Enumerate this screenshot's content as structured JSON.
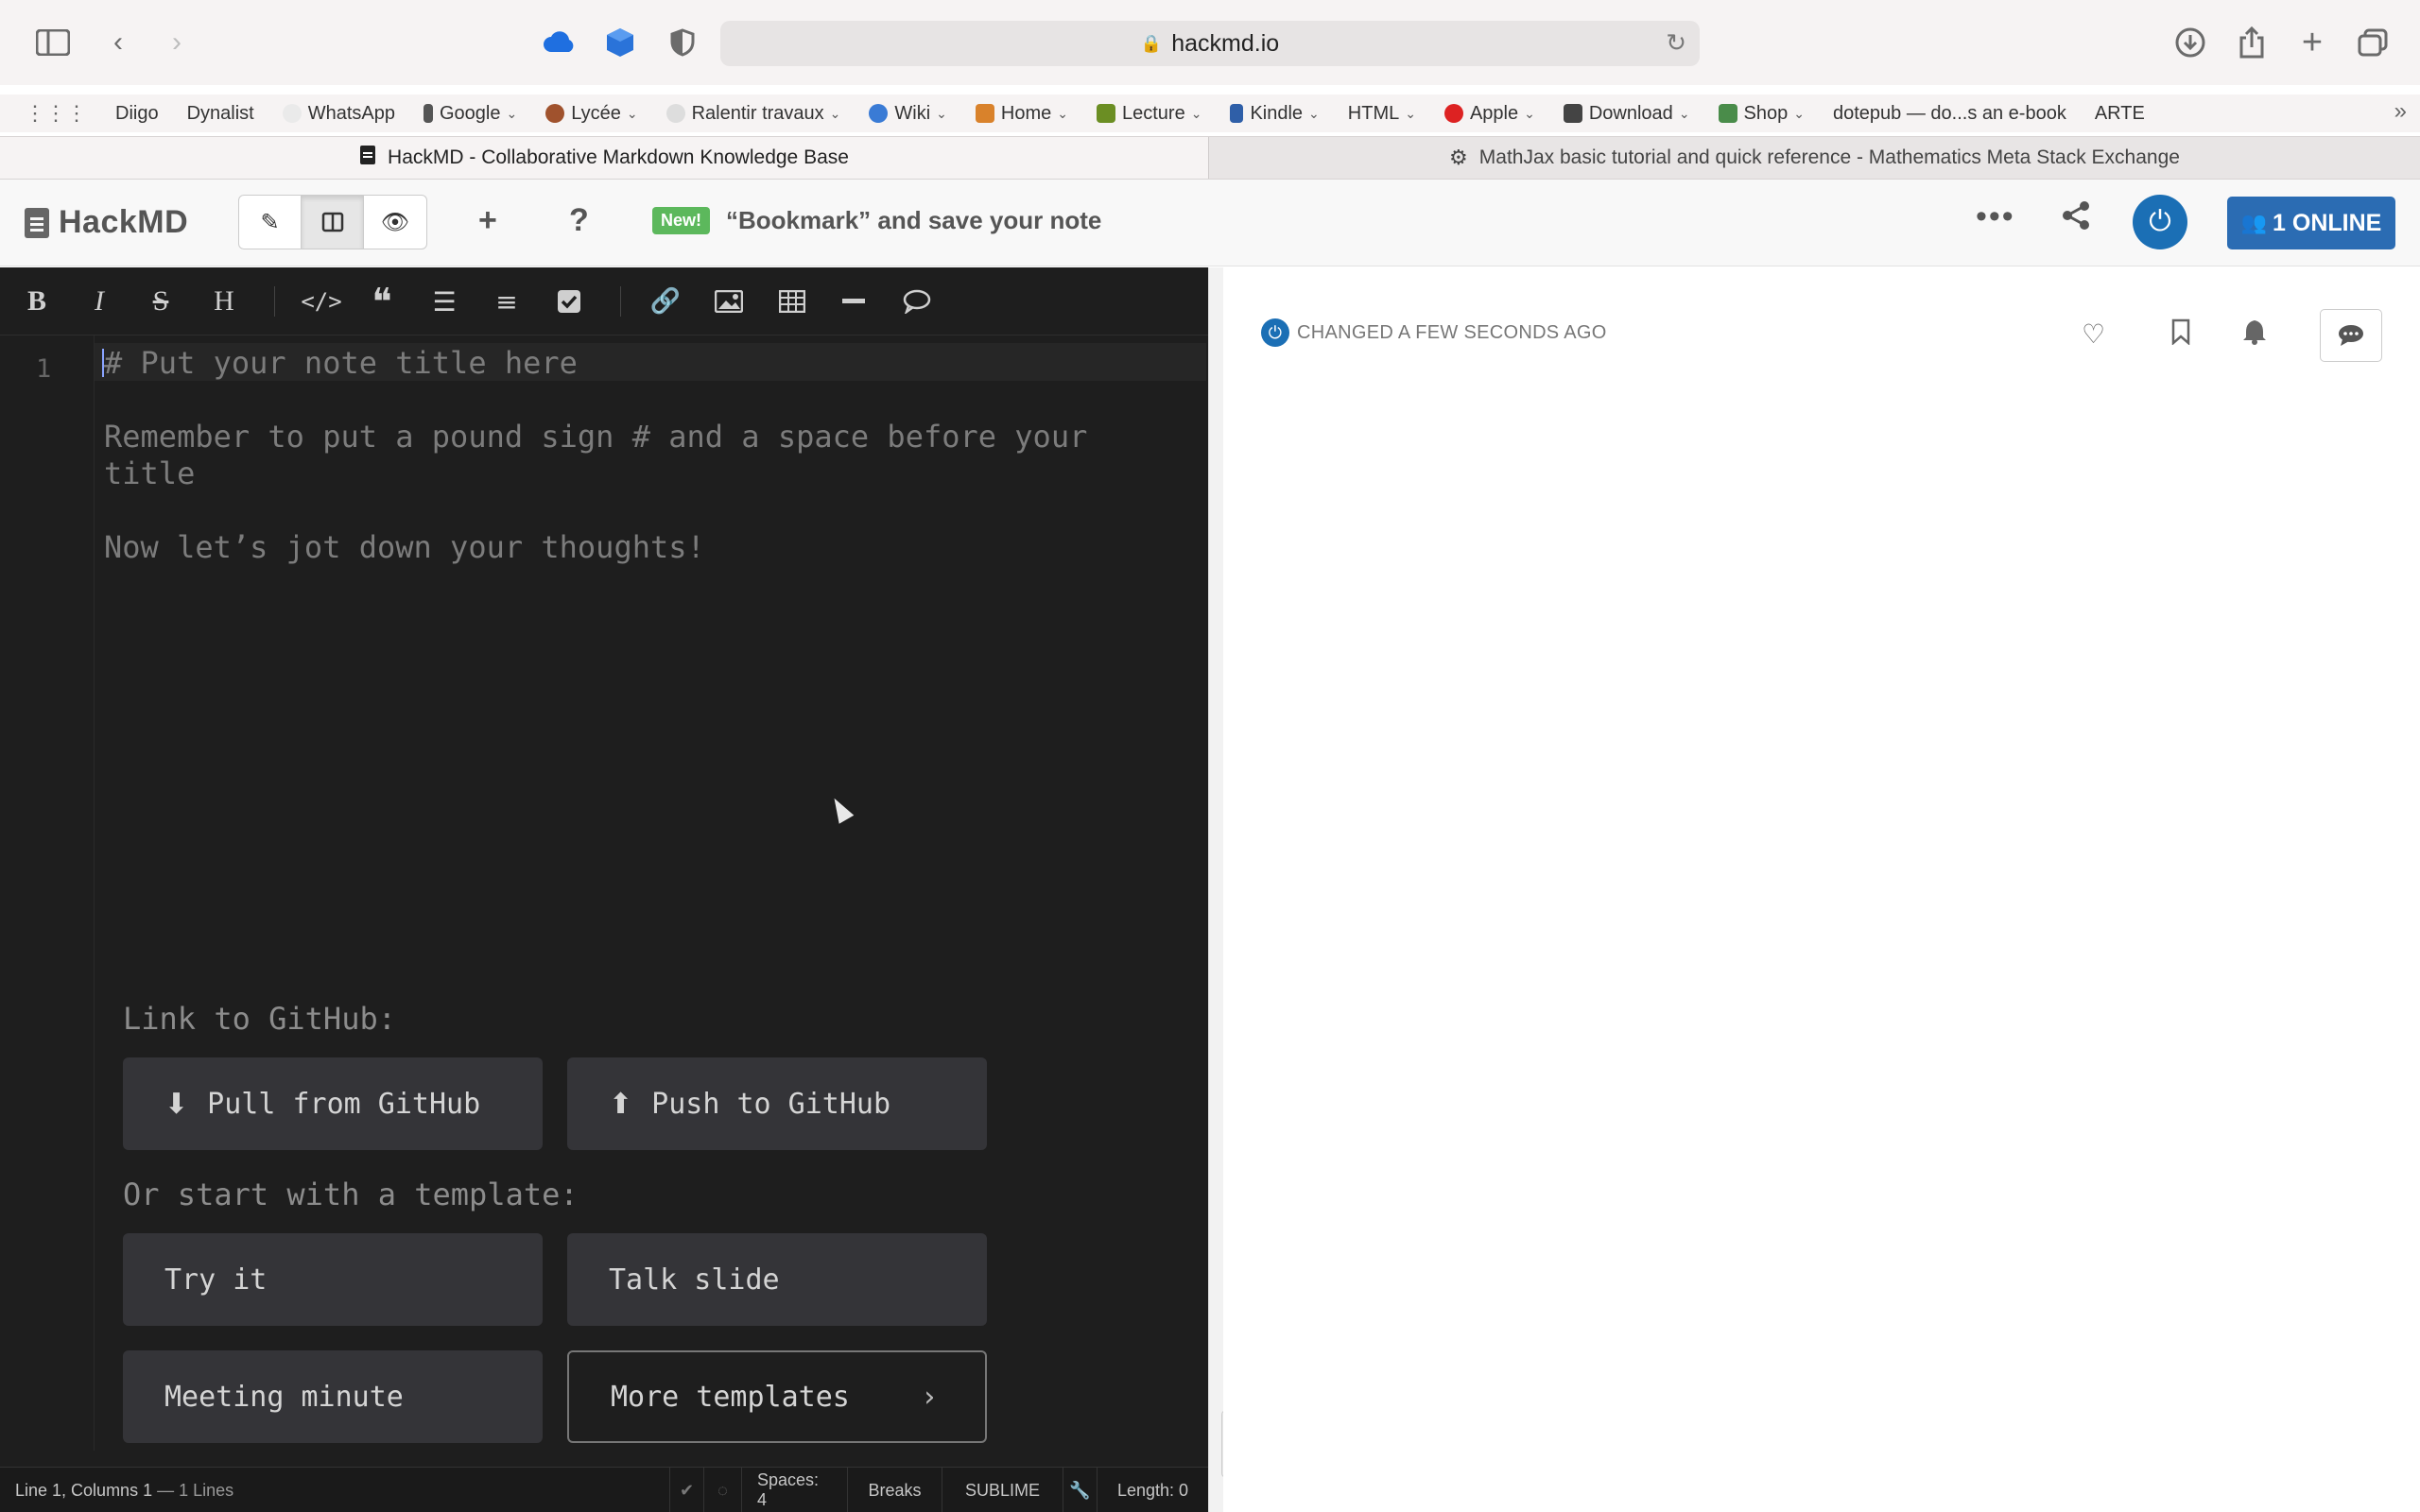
{
  "browser": {
    "url": "hackmd.io",
    "bookmarks": [
      "Diigo",
      "Dynalist",
      "WhatsApp",
      "Google",
      "Lycée",
      "Ralentir travaux",
      "Wiki",
      "Home",
      "Lecture",
      "Kindle",
      "HTML",
      "Apple",
      "Download",
      "Shop",
      "dotepub — do...s an e-book",
      "ARTE"
    ],
    "tabs": [
      {
        "title": "HackMD - Collaborative Markdown Knowledge Base",
        "active": true
      },
      {
        "title": "MathJax basic tutorial and quick reference - Mathematics Meta Stack Exchange",
        "active": false
      }
    ]
  },
  "header": {
    "brand": "HackMD",
    "new_badge": "New!",
    "announcement": "“Bookmark” and save your note",
    "online_label": "1 ONLINE"
  },
  "editor": {
    "line_number": "1",
    "lines": {
      "title": "# Put your note title here",
      "reminder_1": "Remember to put a pound sign # and a space before your",
      "reminder_2": "title",
      "thoughts": "Now let’s jot down your thoughts!"
    },
    "github_label": "Link to GitHub:",
    "pull_label": "Pull from GitHub",
    "push_label": "Push to GitHub",
    "template_label": "Or start with a template:",
    "templates": [
      "Try it",
      "Talk slide",
      "Meeting minute",
      "More templates"
    ]
  },
  "status": {
    "position": "Line 1, Columns 1",
    "lines": "— 1 Lines",
    "spaces": "Spaces: 4",
    "breaks": "Breaks",
    "keymap": "SUBLIME",
    "length": "Length: 0"
  },
  "preview": {
    "changed": "CHANGED A FEW SECONDS AGO"
  },
  "colors": {
    "brand_blue": "#2b6cb3",
    "new_green": "#5cb85c",
    "editor_bg": "#1e1e1e"
  }
}
